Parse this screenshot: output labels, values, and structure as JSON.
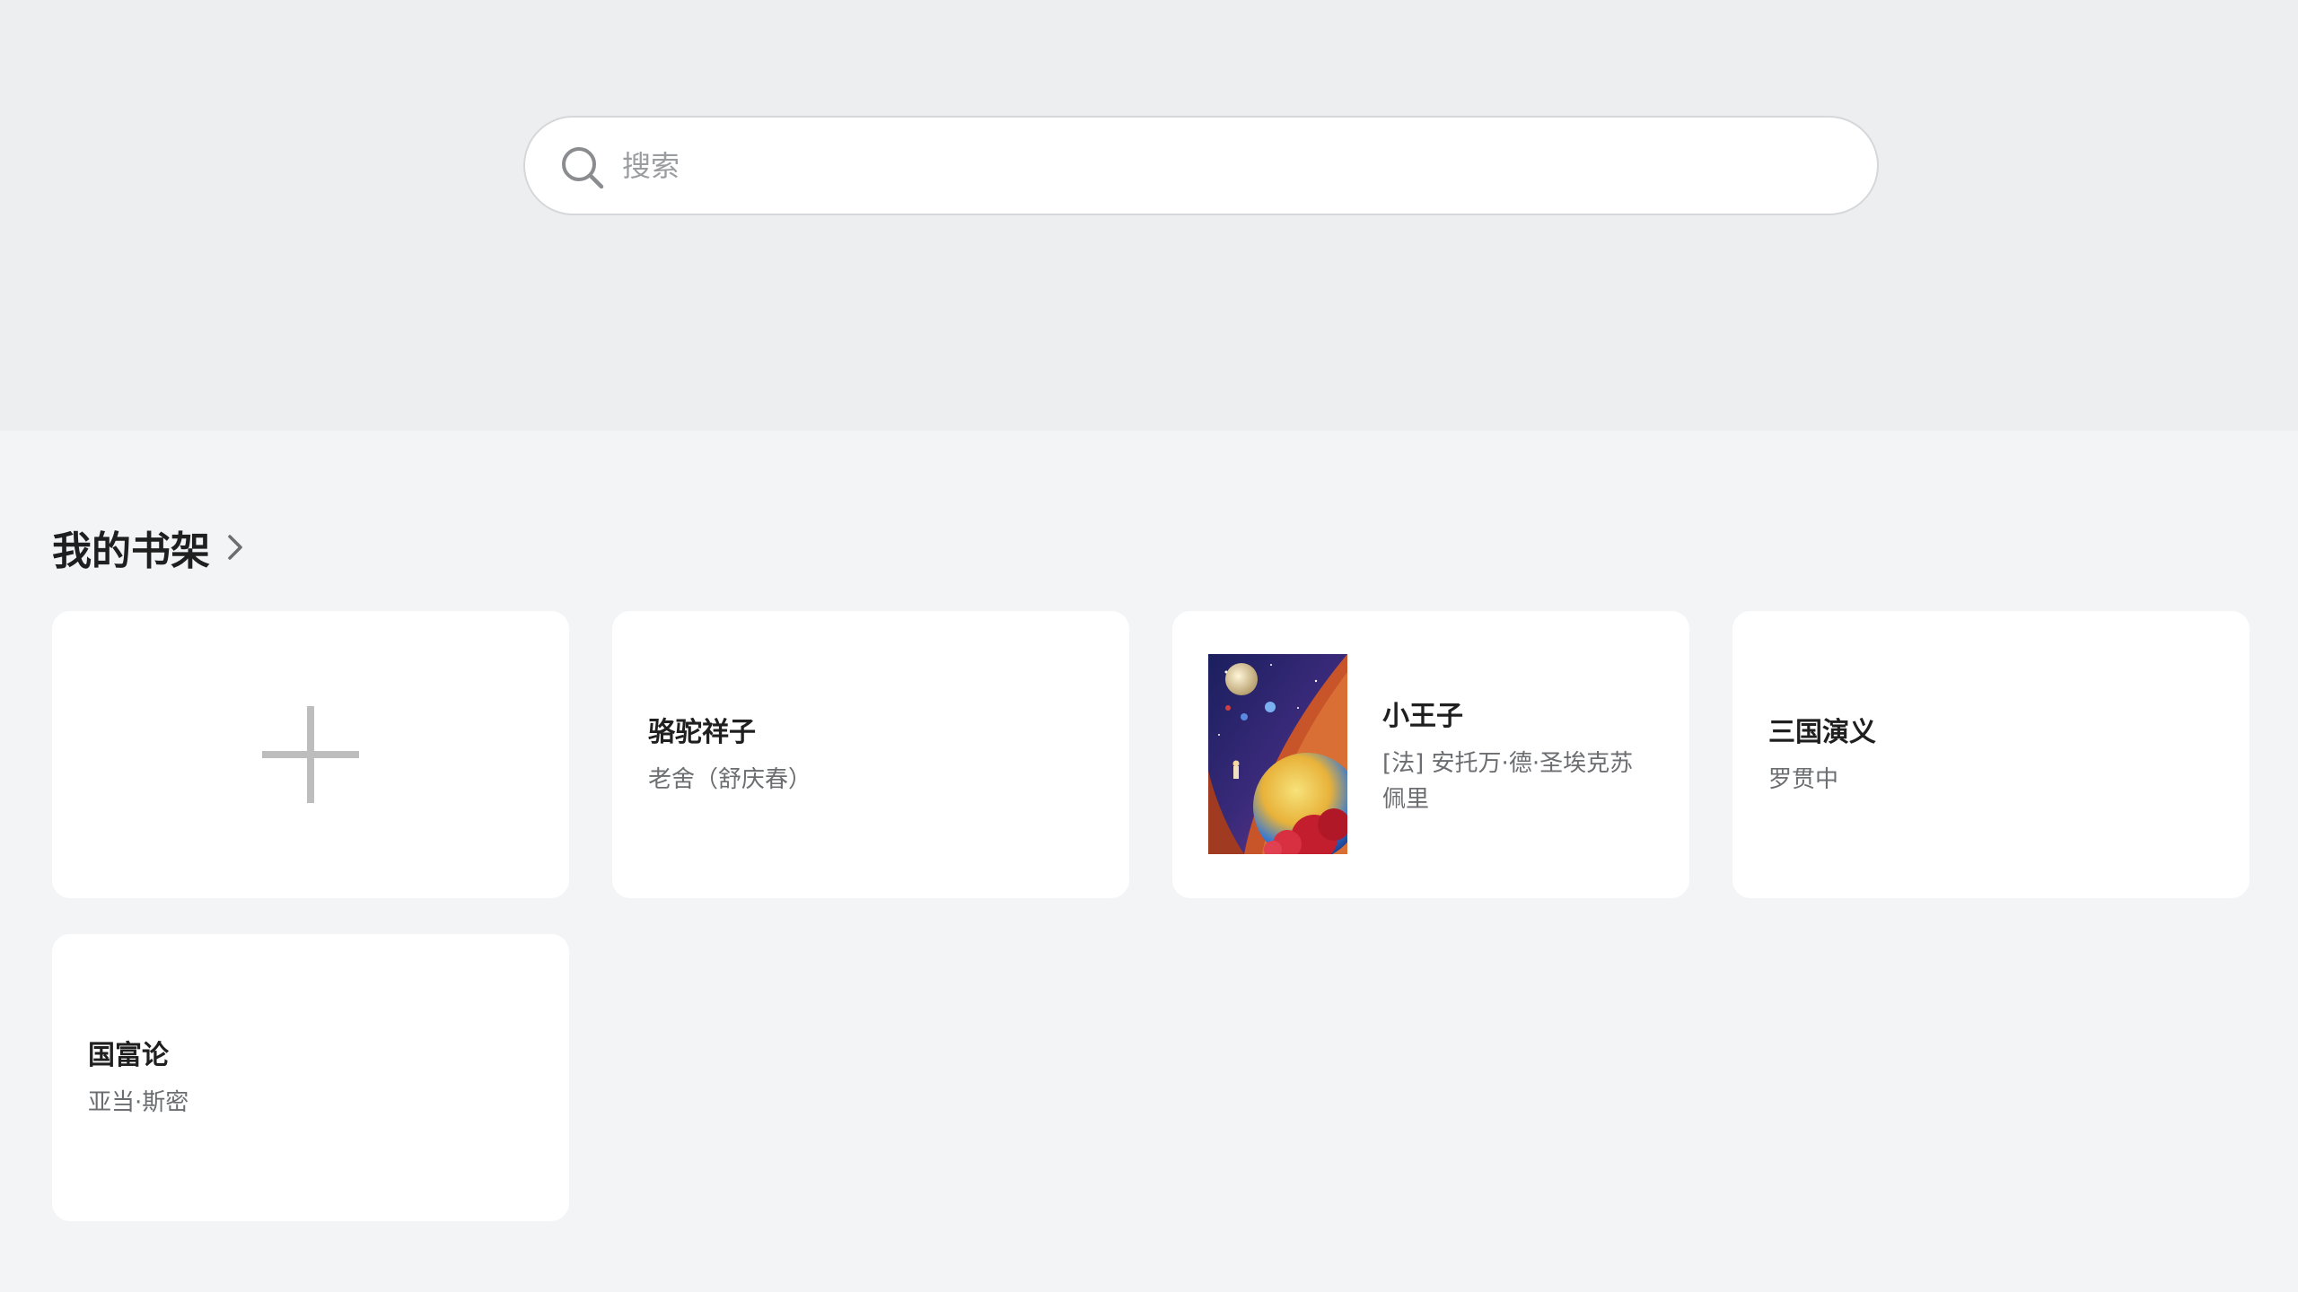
{
  "search": {
    "placeholder": "搜索",
    "value": ""
  },
  "shelf": {
    "title": "我的书架",
    "add_icon": "plus-icon",
    "books": [
      {
        "title": "骆驼祥子",
        "author": "老舍（舒庆春）",
        "has_cover": false
      },
      {
        "title": "小王子",
        "author": "[法] 安托万·德·圣埃克苏佩里",
        "has_cover": true,
        "cover": "space-planet-illustration"
      },
      {
        "title": "三国演义",
        "author": "罗贯中",
        "has_cover": false
      },
      {
        "title": "国富论",
        "author": "亚当·斯密",
        "has_cover": false
      }
    ]
  },
  "colors": {
    "top_bg": "#edeef0",
    "page_bg": "#f3f4f6",
    "card_bg": "#ffffff",
    "title_text": "#1f1f1f",
    "secondary_text": "#6b6d70",
    "plus": "#bdbdbd"
  }
}
